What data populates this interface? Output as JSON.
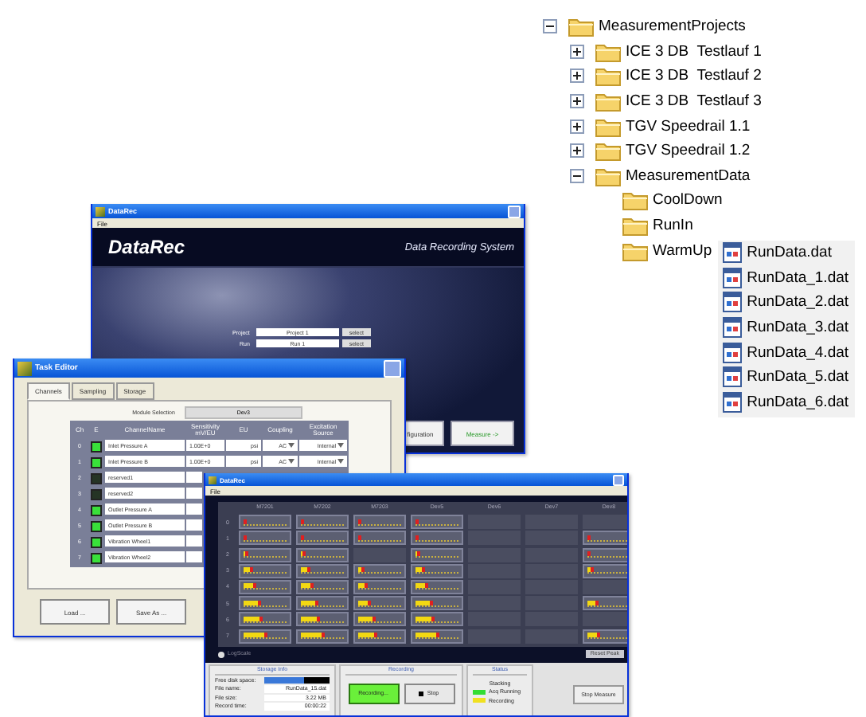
{
  "file_tree": {
    "items": [
      {
        "label": "MeasurementProjects",
        "expanded": true,
        "children": [
          {
            "label": "ICE 3 DB  Testlauf 1",
            "expanded": false
          },
          {
            "label": "ICE 3 DB  Testlauf 2",
            "expanded": false
          },
          {
            "label": "ICE 3 DB  Testlauf 3",
            "expanded": false
          },
          {
            "label": "TGV Speedrail 1.1",
            "expanded": false
          },
          {
            "label": "TGV Speedrail 1.2",
            "expanded": false
          },
          {
            "label": "MeasurementData",
            "expanded": true,
            "children": [
              {
                "label": "CoolDown"
              },
              {
                "label": "RunIn"
              },
              {
                "label": "WarmUp",
                "files": [
                  "RunData.dat",
                  "RunData_1.dat",
                  "RunData_2.dat",
                  "RunData_3.dat",
                  "RunData_4.dat",
                  "RunData_5.dat",
                  "RunData_6.dat"
                ]
              }
            ]
          }
        ]
      }
    ]
  },
  "main_window": {
    "title": "DataRec",
    "menu": [
      "File"
    ],
    "logo": "DataRec",
    "subtitle": "Data Recording System",
    "fields": [
      {
        "label": "Project",
        "value": "Project 1",
        "button": "select"
      },
      {
        "label": "Run",
        "value": "Run 1",
        "button": "select"
      }
    ],
    "buttons": [
      {
        "label": "figuration",
        "kind": "plain"
      },
      {
        "label": "Measure ->",
        "kind": "accent"
      }
    ]
  },
  "task_editor": {
    "title": "Task Editor",
    "tabs": [
      {
        "label": "Channels",
        "selected": true
      },
      {
        "label": "Sampling",
        "selected": false
      },
      {
        "label": "Storage",
        "selected": false
      }
    ],
    "module_selection": {
      "label": "Module Selection",
      "value": "Dev3"
    },
    "columns": [
      "Ch",
      "E",
      "ChannelName",
      "Sensitivity mV/EU",
      "EU",
      "Coupling",
      "Excitation Source"
    ],
    "rows": [
      {
        "ch": "0",
        "enabled": true,
        "name": "Inlet Pressure A",
        "sensitivity": "1.00E+0",
        "eu": "psi",
        "coupling": "AC",
        "excitation": "Internal"
      },
      {
        "ch": "1",
        "enabled": true,
        "name": "Inlet Pressure B",
        "sensitivity": "1.00E+0",
        "eu": "psi",
        "coupling": "AC",
        "excitation": "Internal"
      },
      {
        "ch": "2",
        "enabled": false,
        "name": "reserved1"
      },
      {
        "ch": "3",
        "enabled": false,
        "name": "reserved2"
      },
      {
        "ch": "4",
        "enabled": true,
        "name": "Outlet Pressure A"
      },
      {
        "ch": "5",
        "enabled": true,
        "name": "Outlet Pressure B"
      },
      {
        "ch": "6",
        "enabled": true,
        "name": "Vibration Wheel1"
      },
      {
        "ch": "7",
        "enabled": true,
        "name": "Vibration Wheel2"
      }
    ],
    "buttons": [
      "Load ...",
      "Save As ..."
    ]
  },
  "measure_window": {
    "title": "DataRec",
    "menu": [
      "File"
    ],
    "columns": [
      "M7201",
      "M7202",
      "M7203",
      "Dev5",
      "Dev6",
      "Dev7",
      "Dev8"
    ],
    "rows": [
      {
        "label": "0",
        "cells": [
          {
            "kind": "meter",
            "level": 0.01
          },
          {
            "kind": "meter",
            "level": 0.01
          },
          {
            "kind": "meter",
            "level": 0.01
          },
          {
            "kind": "meter",
            "level": 0.01
          },
          {
            "kind": "empty"
          },
          {
            "kind": "empty"
          },
          {
            "kind": "empty"
          }
        ]
      },
      {
        "label": "1",
        "cells": [
          {
            "kind": "meter",
            "level": 0.06
          },
          {
            "kind": "meter",
            "level": 0.06
          },
          {
            "kind": "meter",
            "level": 0.06
          },
          {
            "kind": "meter",
            "level": 0.06
          },
          {
            "kind": "empty"
          },
          {
            "kind": "empty"
          },
          {
            "kind": "meter",
            "level": 0.01
          }
        ]
      },
      {
        "label": "2",
        "cells": [
          {
            "kind": "meter",
            "level": 0.12
          },
          {
            "kind": "meter",
            "level": 0.12
          },
          {
            "kind": "empty"
          },
          {
            "kind": "meter",
            "level": 0.12
          },
          {
            "kind": "empty"
          },
          {
            "kind": "empty"
          },
          {
            "kind": "meter",
            "level": 0.08
          }
        ]
      },
      {
        "label": "3",
        "cells": [
          {
            "kind": "meter",
            "level": 0.22
          },
          {
            "kind": "meter",
            "level": 0.22
          },
          {
            "kind": "meter",
            "level": 0.15
          },
          {
            "kind": "meter",
            "level": 0.22
          },
          {
            "kind": "empty"
          },
          {
            "kind": "empty"
          },
          {
            "kind": "meter",
            "level": 0.15
          }
        ]
      },
      {
        "label": "4",
        "cells": [
          {
            "kind": "meter",
            "level": 0.3
          },
          {
            "kind": "meter",
            "level": 0.3
          },
          {
            "kind": "meter",
            "level": 0.22
          },
          {
            "kind": "meter",
            "level": 0.3
          },
          {
            "kind": "empty"
          },
          {
            "kind": "empty"
          },
          {
            "kind": "empty"
          }
        ]
      },
      {
        "label": "5",
        "cells": [
          {
            "kind": "meter",
            "level": 0.4
          },
          {
            "kind": "meter",
            "level": 0.4
          },
          {
            "kind": "meter",
            "level": 0.3
          },
          {
            "kind": "meter",
            "level": 0.4
          },
          {
            "kind": "empty"
          },
          {
            "kind": "empty"
          },
          {
            "kind": "meter",
            "level": 0.25
          }
        ]
      },
      {
        "label": "6",
        "cells": [
          {
            "kind": "meter",
            "level": 0.45
          },
          {
            "kind": "meter",
            "level": 0.45
          },
          {
            "kind": "meter",
            "level": 0.4
          },
          {
            "kind": "meter",
            "level": 0.45
          },
          {
            "kind": "empty"
          },
          {
            "kind": "empty"
          },
          {
            "kind": "empty"
          }
        ]
      },
      {
        "label": "7",
        "cells": [
          {
            "kind": "meter",
            "level": 0.55
          },
          {
            "kind": "meter",
            "level": 0.55
          },
          {
            "kind": "meter",
            "level": 0.45
          },
          {
            "kind": "meter",
            "level": 0.55
          },
          {
            "kind": "empty"
          },
          {
            "kind": "empty"
          },
          {
            "kind": "meter",
            "level": 0.3
          }
        ]
      }
    ],
    "log_scale": {
      "label": "LogScale",
      "checked": false
    },
    "reset_button": "Reset Peak",
    "storage_info": {
      "title": "Storage Info",
      "rows": [
        {
          "label": "Free disk space:",
          "level": 0.62
        },
        {
          "label": "File name:",
          "value": "RunData_15.dat"
        },
        {
          "label": "File size:",
          "value": "3.22 MB"
        },
        {
          "label": "Record time:",
          "value": "00:00:22"
        }
      ]
    },
    "recording": {
      "title": "Recording",
      "buttons": [
        {
          "label": "Recording...",
          "active": true
        },
        {
          "label": "Stop",
          "active": false
        }
      ]
    },
    "status": {
      "title": "Status",
      "text": "Stacking",
      "legend": [
        {
          "label": "Acq Running",
          "color": "#33dd33"
        },
        {
          "label": "Recording",
          "color": "#f0e020"
        }
      ]
    },
    "stop_button": "Stop Measure"
  }
}
